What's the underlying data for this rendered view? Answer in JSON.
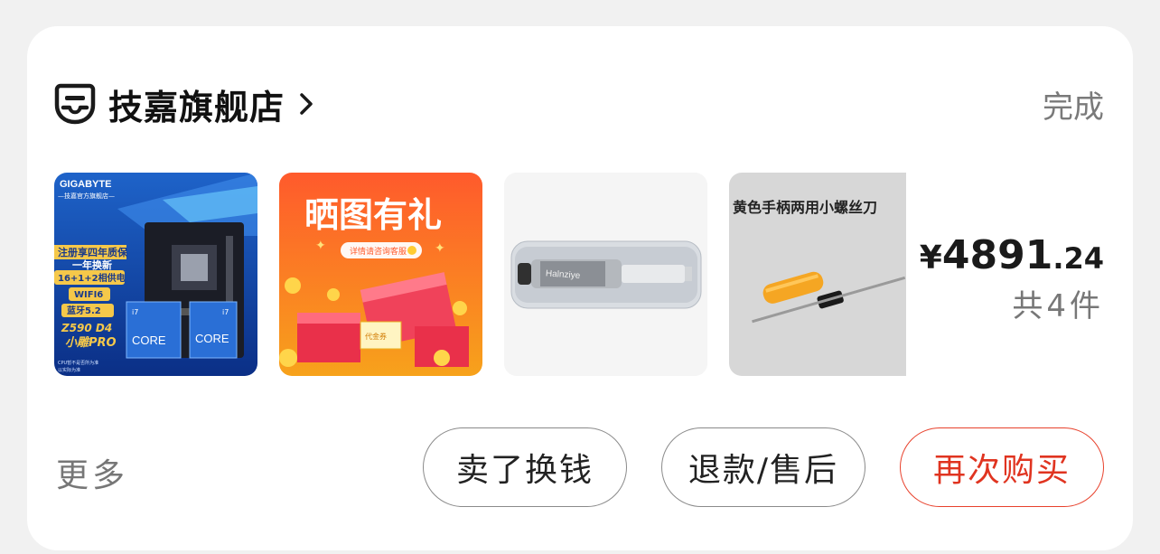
{
  "store": {
    "name": "技嘉旗舰店",
    "icon": "store-face-icon",
    "chevron": "chevron-right-icon"
  },
  "order": {
    "status": "完成",
    "price_currency": "¥",
    "price_integer": "4891",
    "price_decimal": ".24",
    "item_count_text": "共4件"
  },
  "products": [
    {
      "name": "motherboard-thumbnail",
      "texts": [
        "GIGABYTE",
        "—技嘉官方旗舰店—",
        "注册享四年质保",
        "一年换新",
        "16+1+2相供电",
        "WIFI6",
        "蓝牙5.2",
        "Z590 D4",
        "小雕PRO",
        "CORE",
        "CORE",
        "i7",
        "i7",
        "CPU暂不是否所为准",
        "以实际为准"
      ]
    },
    {
      "name": "review-gift-thumbnail",
      "texts": [
        "晒图有礼",
        "详情请咨询客服",
        "代金券"
      ]
    },
    {
      "name": "thermal-paste-thumbnail",
      "texts": [
        "Halnziye"
      ]
    },
    {
      "name": "screwdriver-thumbnail",
      "texts": [
        "黄色手柄两用小螺丝刀"
      ]
    }
  ],
  "actions": {
    "more": "更多",
    "sell": "卖了换钱",
    "refund": "退款/售后",
    "rebuy": "再次购买"
  },
  "colors": {
    "accent": "#e03420",
    "muted": "#777777",
    "background": "#f1f1f1"
  }
}
